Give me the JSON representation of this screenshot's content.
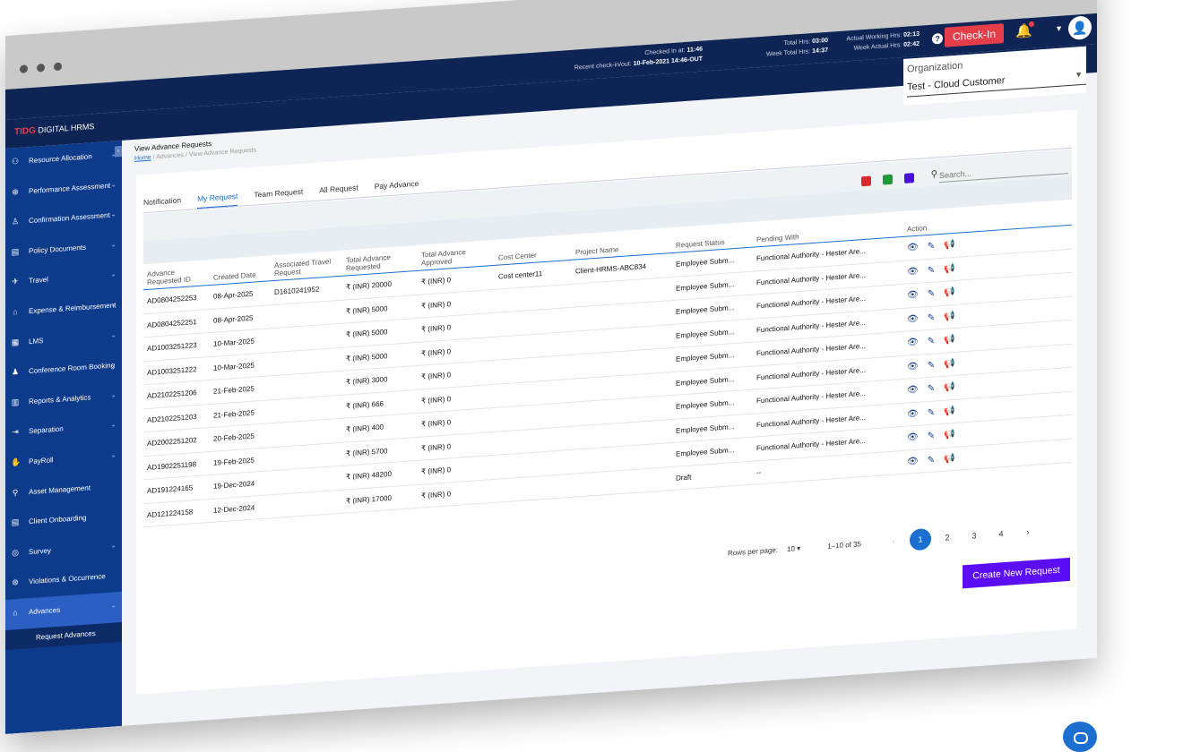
{
  "topbar": {
    "checked_label": "Checked In at:",
    "checked_value": "11:46",
    "recent_label": "Recent check-in/out:",
    "recent_value": "10-Feb-2021 14:46-OUT",
    "total_label": "Total Hrs:",
    "total_value": "03:00",
    "week_total_label": "Week Total Hrs:",
    "week_total_value": "14:37",
    "actual_label": "Actual Working Hrs:",
    "actual_value": "02:13",
    "week_actual_label": "Week Actual Hrs:",
    "week_actual_value": "02:42",
    "checkin_label": "Check-In"
  },
  "brand": {
    "logo": "TIDG",
    "app": "DIGITAL HRMS"
  },
  "organization": {
    "label": "Organization",
    "value": "Test - Cloud Customer"
  },
  "sidebar": {
    "items": [
      {
        "label": "Resource Allocation",
        "icon": "resource-icon"
      },
      {
        "label": "Performance Assessment",
        "icon": "performance-icon"
      },
      {
        "label": "Confirmation Assessment",
        "icon": "confirmation-icon"
      },
      {
        "label": "Policy Documents",
        "icon": "document-icon"
      },
      {
        "label": "Travel",
        "icon": "plane-icon"
      },
      {
        "label": "Expense & Reimbursement",
        "icon": "expense-icon"
      },
      {
        "label": "LMS",
        "icon": "lms-icon"
      },
      {
        "label": "Conference Room Booking",
        "icon": "conference-icon"
      },
      {
        "label": "Reports & Analytics",
        "icon": "reports-icon"
      },
      {
        "label": "Separation",
        "icon": "separation-icon"
      },
      {
        "label": "PayRoll",
        "icon": "payroll-icon"
      },
      {
        "label": "Asset Management",
        "icon": "asset-icon"
      },
      {
        "label": "Client Onboarding",
        "icon": "client-icon"
      },
      {
        "label": "Survey",
        "icon": "survey-icon"
      },
      {
        "label": "Violations & Occurrence",
        "icon": "violation-icon"
      },
      {
        "label": "Advances",
        "icon": "advances-icon"
      }
    ],
    "sub_item": "Request Advances"
  },
  "breadcrumb": {
    "title": "View Advance Requests",
    "home": "Home",
    "sep1": "/",
    "advances": "Advances",
    "sep2": "/",
    "current": "View Advance Requests"
  },
  "tabs": [
    "Notification",
    "My Request",
    "Team Request",
    "All Request",
    "Pay Advance"
  ],
  "search": {
    "placeholder": "Search..."
  },
  "table": {
    "headers": [
      "Advance Requested ID",
      "Created Date",
      "Associated Travel Request",
      "Total Advance Requested",
      "Total Advance Approved",
      "Cost Center",
      "Project Name",
      "Request Status",
      "Pending With",
      "Action"
    ],
    "rows": [
      [
        "AD0804252253",
        "08-Apr-2025",
        "D1610241952",
        "₹ (INR) 20000",
        "₹ (INR) 0",
        "Cost center11",
        "Client-HRMS-ABC834",
        "Employee Subm...",
        "Functional Authority - Hester Are..."
      ],
      [
        "AD0804252251",
        "08-Apr-2025",
        "",
        "₹ (INR) 5000",
        "₹ (INR) 0",
        "",
        "",
        "Employee Subm...",
        "Functional Authority - Hester Are..."
      ],
      [
        "AD1003251223",
        "10-Mar-2025",
        "",
        "₹ (INR) 5000",
        "₹ (INR) 0",
        "",
        "",
        "Employee Subm...",
        "Functional Authority - Hester Are..."
      ],
      [
        "AD1003251222",
        "10-Mar-2025",
        "",
        "₹ (INR) 5000",
        "₹ (INR) 0",
        "",
        "",
        "Employee Subm...",
        "Functional Authority - Hester Are..."
      ],
      [
        "AD2102251206",
        "21-Feb-2025",
        "",
        "₹ (INR) 3000",
        "₹ (INR) 0",
        "",
        "",
        "Employee Subm...",
        "Functional Authority - Hester Are..."
      ],
      [
        "AD2102251203",
        "21-Feb-2025",
        "",
        "₹ (INR) 666",
        "₹ (INR) 0",
        "",
        "",
        "Employee Subm...",
        "Functional Authority - Hester Are..."
      ],
      [
        "AD2002251202",
        "20-Feb-2025",
        "",
        "₹ (INR) 400",
        "₹ (INR) 0",
        "",
        "",
        "Employee Subm...",
        "Functional Authority - Hester Are..."
      ],
      [
        "AD1902251198",
        "19-Feb-2025",
        "",
        "₹ (INR) 5700",
        "₹ (INR) 0",
        "",
        "",
        "Employee Subm...",
        "Functional Authority - Hester Are..."
      ],
      [
        "AD191224165",
        "19-Dec-2024",
        "",
        "₹ (INR) 48200",
        "₹ (INR) 0",
        "",
        "",
        "Employee Subm...",
        "Functional Authority - Hester Are..."
      ],
      [
        "AD121224158",
        "12-Dec-2024",
        "",
        "₹ (INR) 17000",
        "₹ (INR) 0",
        "",
        "",
        "Draft",
        "--"
      ]
    ]
  },
  "pagination": {
    "rows_label": "Rows per page:",
    "rows_value": "10",
    "range": "1–10 of 35",
    "pages": [
      "1",
      "2",
      "3",
      "4"
    ],
    "current": "1"
  },
  "create_button": "Create New Request",
  "colors": {
    "navy": "#0d2455",
    "sidebar": "#0d3b8c",
    "accent": "#1a6fd1",
    "checkin": "#e53e4a",
    "create": "#5b0ef5"
  }
}
